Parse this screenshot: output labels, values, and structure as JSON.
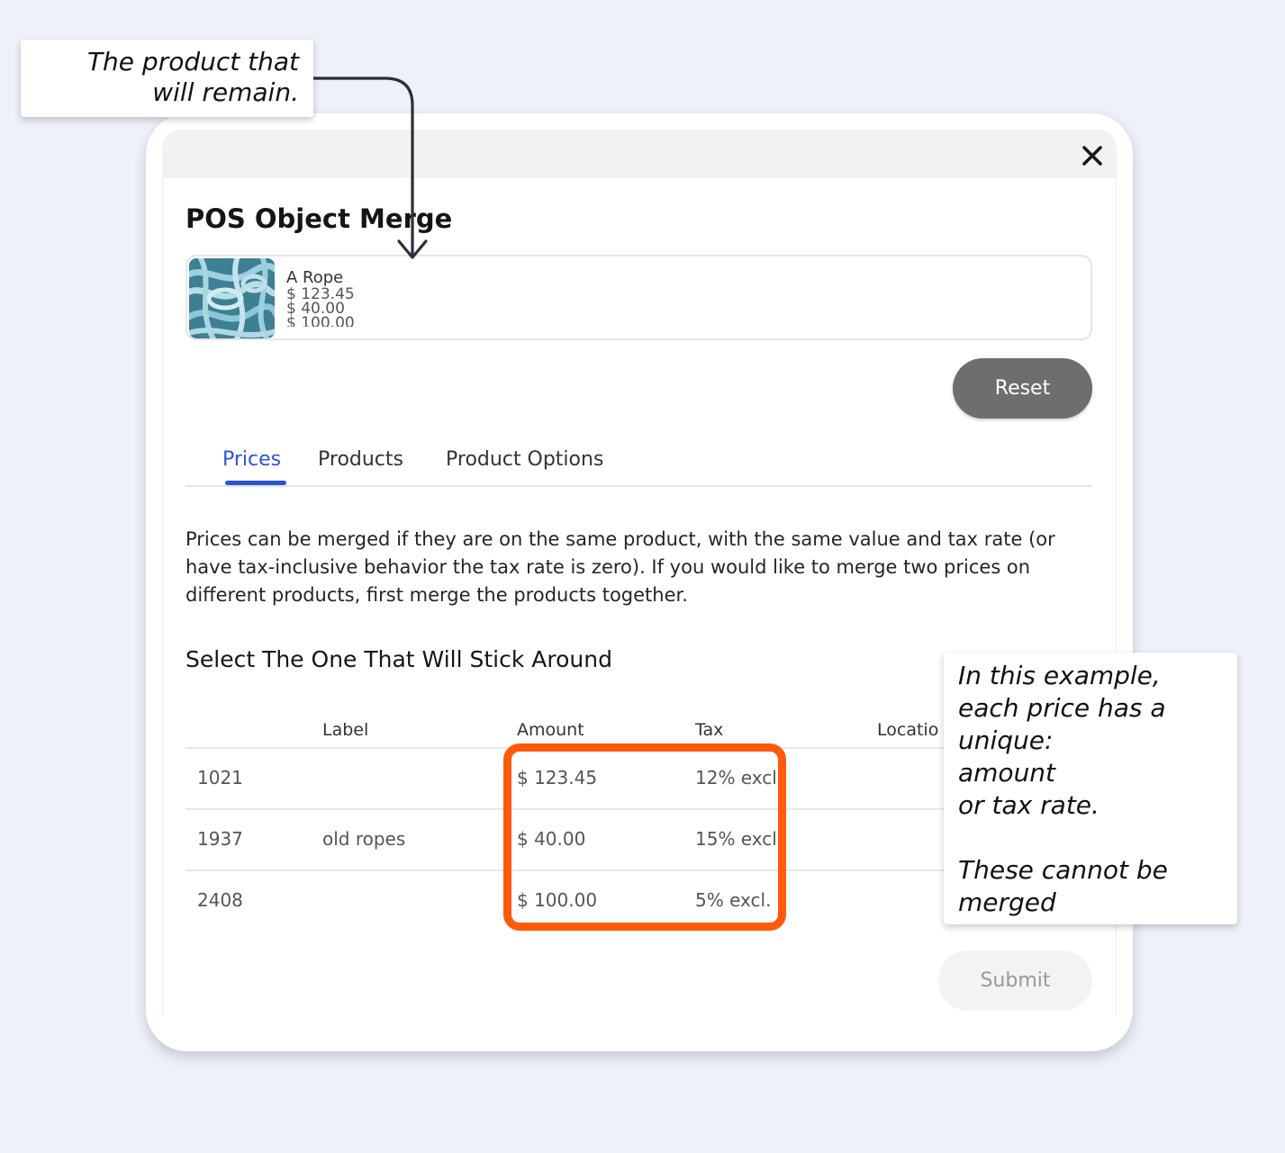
{
  "annotations": {
    "top_callout": [
      "The product that",
      "will remain."
    ],
    "right_callout": [
      "In this example,",
      "each price has a",
      "unique:",
      "amount",
      "or tax rate.",
      "",
      "These cannot be",
      "merged"
    ],
    "highlight_color": "#ff5a0a"
  },
  "modal": {
    "title": "POS Object Merge",
    "close_icon": "close-icon",
    "product": {
      "name": "A Rope",
      "prices": [
        "$ 123.45",
        "$ 40.00",
        "$ 100.00"
      ],
      "thumbnail_icon": "rope-image"
    },
    "reset_label": "Reset",
    "tabs": [
      {
        "label": "Prices",
        "active": true
      },
      {
        "label": "Products",
        "active": false
      },
      {
        "label": "Product Options",
        "active": false
      }
    ],
    "accent_color": "#2b55d8",
    "info_text": "Prices can be merged if they are on the same product, with the same value and tax rate (or have tax-inclusive behavior the tax rate is zero). If you would like to merge two prices on different products, first merge the products together.",
    "subheading": "Select The One That Will Stick Around",
    "table": {
      "columns": [
        "Label",
        "Amount",
        "Tax",
        "Locatio"
      ],
      "rows": [
        {
          "id": "1021",
          "label": "",
          "amount": "$ 123.45",
          "tax": "12% excl."
        },
        {
          "id": "1937",
          "label": "old ropes",
          "amount": "$ 40.00",
          "tax": "15% excl."
        },
        {
          "id": "2408",
          "label": "",
          "amount": "$ 100.00",
          "tax": "5% excl."
        }
      ]
    },
    "submit_label": "Submit"
  }
}
